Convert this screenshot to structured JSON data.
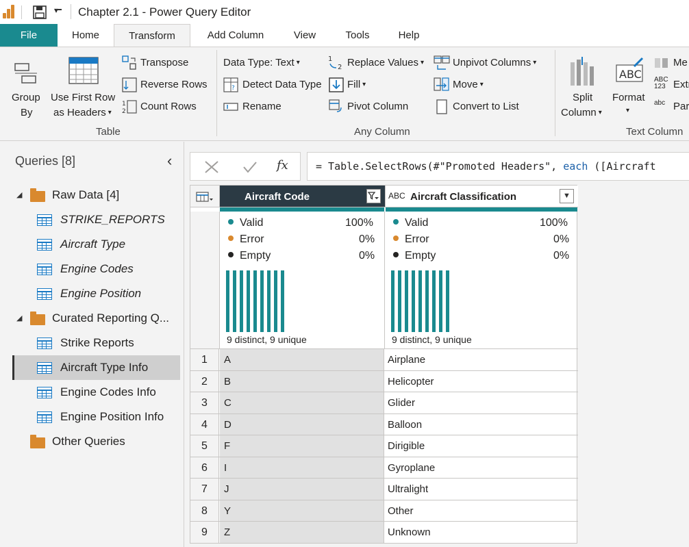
{
  "window": {
    "title": "Chapter 2.1 - Power Query Editor"
  },
  "tabs": [
    "File",
    "Home",
    "Transform",
    "Add Column",
    "View",
    "Tools",
    "Help"
  ],
  "ribbon": {
    "table_group": {
      "group_by_1": "Group",
      "group_by_2": "By",
      "use_first_row_1": "Use First Row",
      "use_first_row_2": "as Headers",
      "transpose": "Transpose",
      "reverse_rows": "Reverse Rows",
      "count_rows": "Count Rows",
      "label": "Table"
    },
    "any_column_group": {
      "data_type": "Data Type: Text",
      "detect_data_type": "Detect Data Type",
      "rename": "Rename",
      "replace_values": "Replace Values",
      "fill": "Fill",
      "pivot_column": "Pivot Column",
      "unpivot_columns": "Unpivot Columns",
      "move": "Move",
      "convert_to_list": "Convert to List",
      "label": "Any Column"
    },
    "text_column_group": {
      "split_column_1": "Split",
      "split_column_2": "Column",
      "format": "Format",
      "merge_partial": "Me",
      "extract_partial": "Extr",
      "parse_partial": "Pars",
      "label": "Text Column"
    }
  },
  "queries_pane": {
    "header": "Queries [8]",
    "groups": [
      {
        "name": "Raw Data [4]",
        "items": [
          "STRIKE_REPORTS",
          "Aircraft Type",
          "Engine Codes",
          "Engine Position"
        ]
      },
      {
        "name": "Curated Reporting Q...",
        "items": [
          "Strike Reports",
          "Aircraft Type Info",
          "Engine Codes Info",
          "Engine Position Info"
        ]
      },
      {
        "name": "Other Queries",
        "items": []
      }
    ],
    "selected": "Aircraft Type Info"
  },
  "formula_bar": {
    "prefix": "= Table.SelectRows(#\"Promoted Headers\", ",
    "keyword": "each",
    "suffix": " ([Aircraft"
  },
  "grid": {
    "type_glyph": "ABC",
    "columns": [
      {
        "name": "Aircraft Code",
        "profile": {
          "valid": "100%",
          "error": "0%",
          "empty": "0%",
          "distinct": "9 distinct, 9 unique"
        }
      },
      {
        "name": "Aircraft Classification",
        "profile": {
          "valid": "100%",
          "error": "0%",
          "empty": "0%",
          "distinct": "9 distinct, 9 unique"
        }
      }
    ],
    "profile_labels": {
      "valid": "Valid",
      "error": "Error",
      "empty": "Empty"
    },
    "rows": [
      {
        "n": "1",
        "code": "A",
        "classification": "Airplane"
      },
      {
        "n": "2",
        "code": "B",
        "classification": "Helicopter"
      },
      {
        "n": "3",
        "code": "C",
        "classification": "Glider"
      },
      {
        "n": "4",
        "code": "D",
        "classification": "Balloon"
      },
      {
        "n": "5",
        "code": "F",
        "classification": "Dirigible"
      },
      {
        "n": "6",
        "code": "I",
        "classification": "Gyroplane"
      },
      {
        "n": "7",
        "code": "J",
        "classification": "Ultralight"
      },
      {
        "n": "8",
        "code": "Y",
        "classification": "Other"
      },
      {
        "n": "9",
        "code": "Z",
        "classification": "Unknown"
      }
    ]
  },
  "colors": {
    "accent": "#1a8a8f",
    "error_dot": "#d9892e",
    "empty_dot": "#252423",
    "folder": "#d9892e",
    "header_dark": "#2b3a44"
  }
}
